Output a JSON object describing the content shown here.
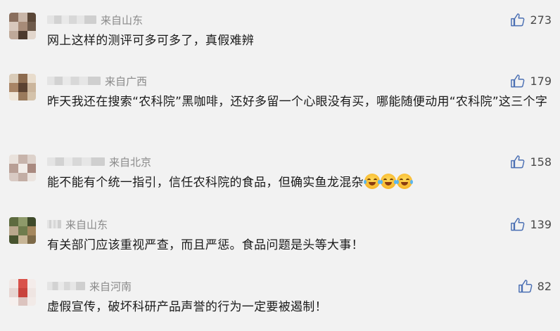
{
  "comments": [
    {
      "location": "来自山东",
      "text": "网上这样的测评可多可多了，真假难辨",
      "likes": "273",
      "avatar_colors": [
        "#8a6f5e",
        "#c9b6a8",
        "#5a4637",
        "#d8c8bc",
        "#a78b78",
        "#6e5a4b",
        "#bfa999",
        "#4d3a2d",
        "#e2d6cc"
      ]
    },
    {
      "location": "来自广西",
      "text": "昨天我还在搜索“农科院”黑咖啡，还好多留一个心眼没有买，哪能随便动用“农科院”这三个字",
      "likes": "179",
      "avatar_colors": [
        "#d9cbb8",
        "#8c6b4f",
        "#e8dccc",
        "#a88465",
        "#5b4231",
        "#cbb59c",
        "#f0e6d8",
        "#9a7a5c",
        "#d4c2aa"
      ]
    },
    {
      "location": "来自北京",
      "text": "能不能有个统一指引，信任农科院的食品，但确实鱼龙混杂",
      "likes": "158",
      "avatar_colors": [
        "#e9e2dc",
        "#c7b4ab",
        "#ddd2cb",
        "#b89f95",
        "#f2ede9",
        "#a98a80",
        "#d8cac3",
        "#c3aea5",
        "#ebe4df"
      ]
    },
    {
      "location": "来自山东",
      "text": "有关部门应该重视严查，而且严惩。食品问题是头等大事！",
      "likes": "139",
      "avatar_colors": [
        "#5d6b3f",
        "#8e9a6a",
        "#3e4a2a",
        "#b9a78c",
        "#6f7c4d",
        "#a4875e",
        "#48542f",
        "#c7b596",
        "#7d6a48"
      ]
    },
    {
      "location": "来自河南",
      "text": "虚假宣传，破坏科研产品声誉的行为一定要被遏制！",
      "likes": "82",
      "avatar_colors": [
        "#f1e9e6",
        "#d9524a",
        "#f4ecea",
        "#e7d6d2",
        "#c8433c",
        "#efe5e2",
        "#f6f0ee",
        "#dcc4bf",
        "#f2eae7"
      ]
    }
  ],
  "emoji_name": "laughing-tears-emoji",
  "colors": {
    "background": "#f2f2f2",
    "text": "#1a1a1a",
    "location": "#8a8a8a",
    "like_icon": "#4a6fb3",
    "like_count": "#4a4a4a"
  }
}
